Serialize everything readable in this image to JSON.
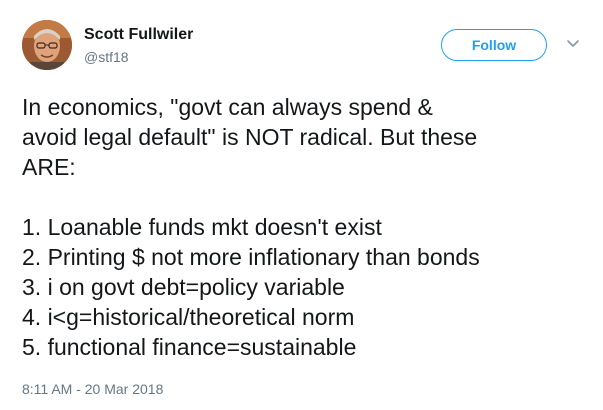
{
  "user": {
    "name": "Scott Fullwiler",
    "handle": "@stf18"
  },
  "actions": {
    "follow_label": "Follow",
    "menu_icon": "chevron-down-icon"
  },
  "tweet": {
    "lines": [
      "In economics, \"govt can always spend &",
      "avoid legal default\" is NOT radical. But these",
      "ARE:",
      "",
      "1. Loanable funds mkt doesn't exist",
      "2. Printing $ not more inflationary than bonds",
      "3. i on govt debt=policy variable",
      "4. i<g=historical/theoretical norm",
      "5. functional finance=sustainable"
    ],
    "timestamp": "8:11 AM - 20 Mar 2018"
  },
  "colors": {
    "accent": "#1da1f2",
    "text": "#14171a",
    "secondary": "#657786"
  }
}
